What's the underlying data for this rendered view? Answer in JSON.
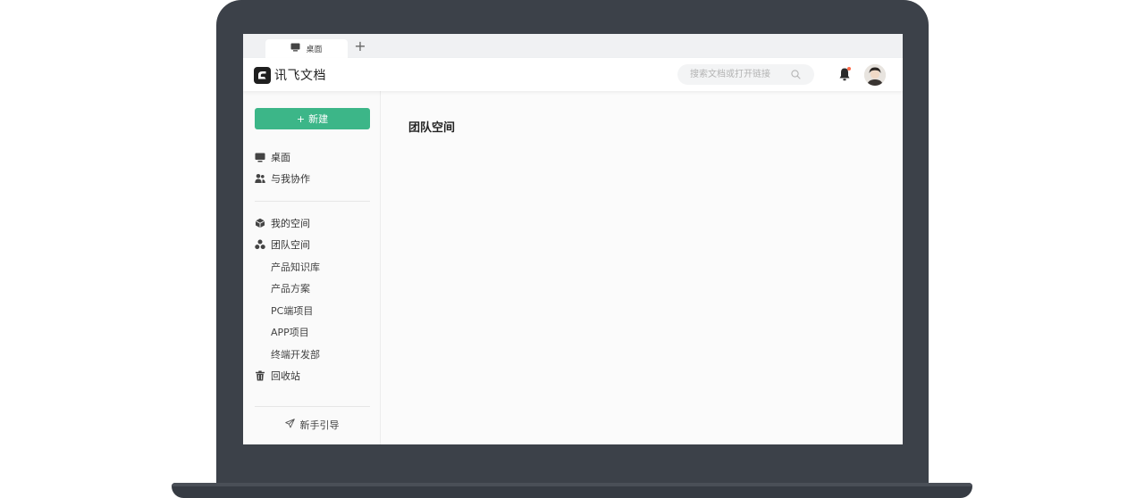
{
  "browser": {
    "tab_label": "桌面",
    "add_tab_glyph": "+"
  },
  "header": {
    "app_name": "讯飞文档",
    "search_placeholder": "搜索文档或打开链接",
    "has_notification": true
  },
  "sidebar": {
    "new_button_label": "新建",
    "new_button_glyph": "+",
    "primary_items": [
      {
        "label": "桌面",
        "icon": "desktop-icon"
      },
      {
        "label": "与我协作",
        "icon": "users-icon"
      }
    ],
    "space_items": [
      {
        "label": "我的空间",
        "icon": "cube-icon"
      },
      {
        "label": "团队空间",
        "icon": "team-icon"
      }
    ],
    "team_spaces": [
      "产品知识库",
      "产品方案",
      "PC端项目",
      "APP项目",
      "终端开发部"
    ],
    "trash": {
      "label": "回收站",
      "icon": "trash-icon"
    },
    "guide_label": "新手引导"
  },
  "main": {
    "title": "团队空间"
  },
  "colors": {
    "accent": "#3cb688",
    "laptop_frame": "#3c4149",
    "notification_dot": "#ff6b4a"
  }
}
